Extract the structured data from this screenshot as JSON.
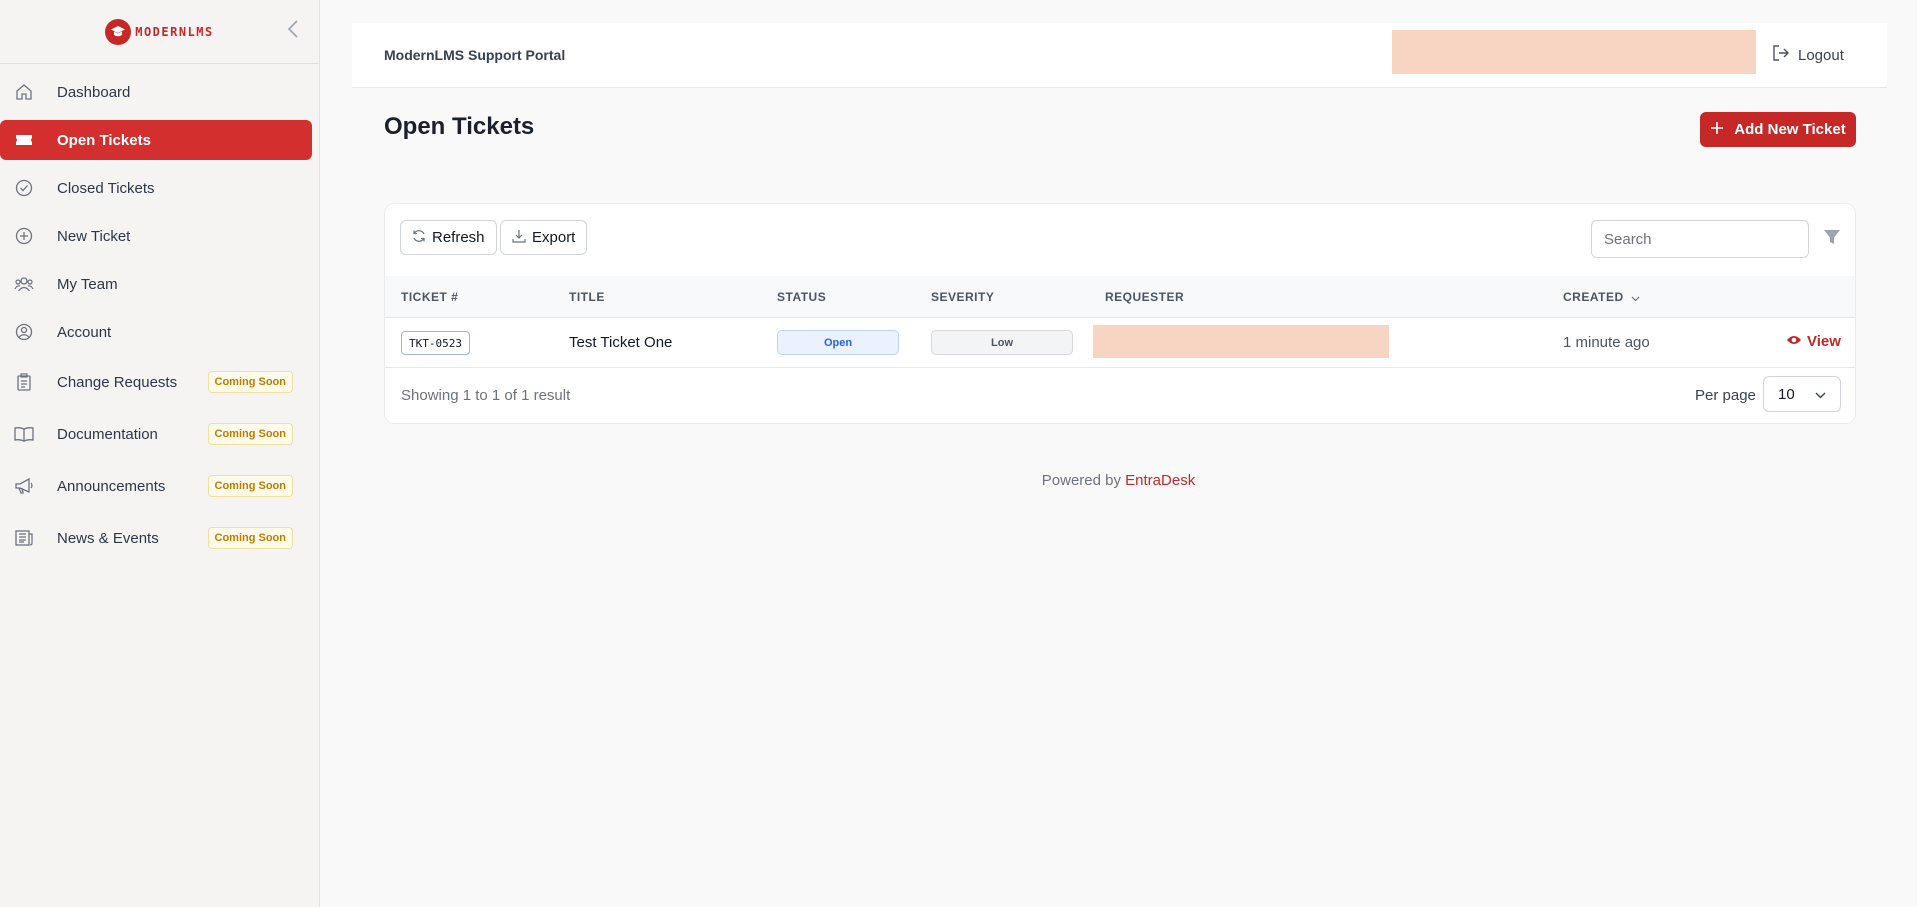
{
  "brand": {
    "name": "MODERNLMS"
  },
  "sidebar": {
    "items": [
      {
        "label": "Dashboard",
        "icon": "home-icon"
      },
      {
        "label": "Open Tickets",
        "icon": "ticket-icon",
        "active": true
      },
      {
        "label": "Closed Tickets",
        "icon": "check-circle-icon"
      },
      {
        "label": "New Ticket",
        "icon": "plus-circle-icon"
      },
      {
        "label": "My Team",
        "icon": "team-icon"
      },
      {
        "label": "Account",
        "icon": "user-circle-icon"
      },
      {
        "label": "Change Requests",
        "icon": "clipboard-icon",
        "badge": "Coming Soon"
      },
      {
        "label": "Documentation",
        "icon": "book-icon",
        "badge": "Coming Soon"
      },
      {
        "label": "Announcements",
        "icon": "megaphone-icon",
        "badge": "Coming Soon"
      },
      {
        "label": "News & Events",
        "icon": "newspaper-icon",
        "badge": "Coming Soon"
      }
    ]
  },
  "header": {
    "title": "ModernLMS Support Portal",
    "logout_label": "Logout"
  },
  "page": {
    "title": "Open Tickets",
    "add_button": "Add New Ticket"
  },
  "toolbar": {
    "refresh_label": "Refresh",
    "export_label": "Export",
    "search_placeholder": "Search"
  },
  "table": {
    "columns": [
      "TICKET #",
      "TITLE",
      "STATUS",
      "SEVERITY",
      "REQUESTER",
      "CREATED"
    ],
    "rows": [
      {
        "ticket": "TKT-0523",
        "title": "Test Ticket One",
        "status": "Open",
        "severity": "Low",
        "created": "1 minute ago",
        "action": "View"
      }
    ]
  },
  "pagination": {
    "summary": "Showing 1 to 1 of 1 result",
    "per_page_label": "Per page",
    "per_page_value": "10"
  },
  "footer": {
    "prefix": "Powered by",
    "brand": "EntraDesk"
  },
  "colors": {
    "accent": "#c62828",
    "active_nav": "#d32f2f",
    "redacted": "#f7d5c2"
  }
}
